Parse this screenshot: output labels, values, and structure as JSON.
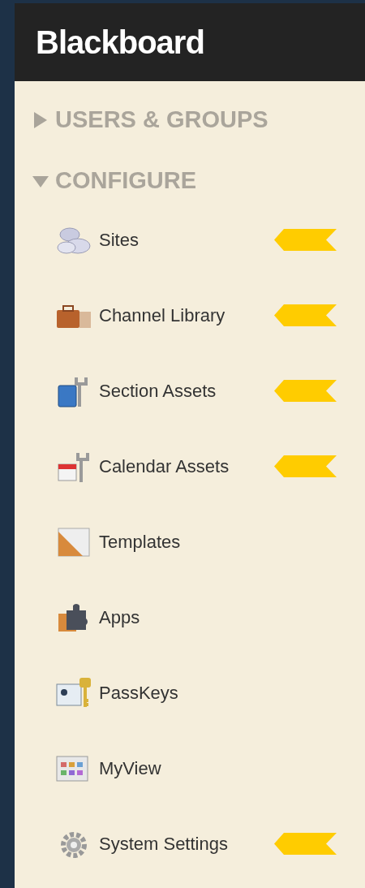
{
  "header": {
    "logo": "Blackboard"
  },
  "sections": [
    {
      "title": "USERS & GROUPS",
      "expanded": false
    },
    {
      "title": "CONFIGURE",
      "expanded": true,
      "items": [
        {
          "label": "Sites",
          "kind": "clouds",
          "flagged": true
        },
        {
          "label": "Channel Library",
          "kind": "briefcase",
          "flagged": true
        },
        {
          "label": "Section Assets",
          "kind": "book-wrench",
          "flagged": true
        },
        {
          "label": "Calendar Assets",
          "kind": "calendar-wrench",
          "flagged": true
        },
        {
          "label": "Templates",
          "kind": "template",
          "flagged": false
        },
        {
          "label": "Apps",
          "kind": "puzzle",
          "flagged": false
        },
        {
          "label": "PassKeys",
          "kind": "key-card",
          "flagged": false
        },
        {
          "label": "MyView",
          "kind": "grid",
          "flagged": false
        },
        {
          "label": "System Settings",
          "kind": "gear",
          "flagged": true
        }
      ]
    }
  ]
}
